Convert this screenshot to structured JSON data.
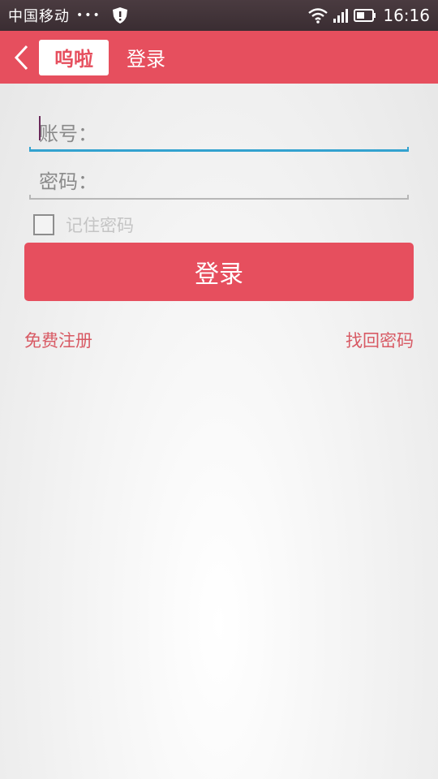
{
  "status_bar": {
    "carrier": "中国移动",
    "dots": "•••",
    "time": "16:16",
    "icons": [
      "shield-icon",
      "wifi-icon",
      "signal-icon",
      "battery-icon"
    ]
  },
  "header": {
    "back_icon": "chevron-left-icon",
    "logo_text": "呜啦",
    "title": "登录",
    "color": "#e64f5e"
  },
  "form": {
    "account_label": "账号：",
    "password_label": "密码：",
    "remember_label": "记住密码",
    "remember_checked": false,
    "login_button": "登录"
  },
  "links": {
    "register": "免费注册",
    "forgot": "找回密码"
  },
  "colors": {
    "accent": "#e64f5e",
    "focus_line": "#33a2cf",
    "link": "#d85a64"
  }
}
